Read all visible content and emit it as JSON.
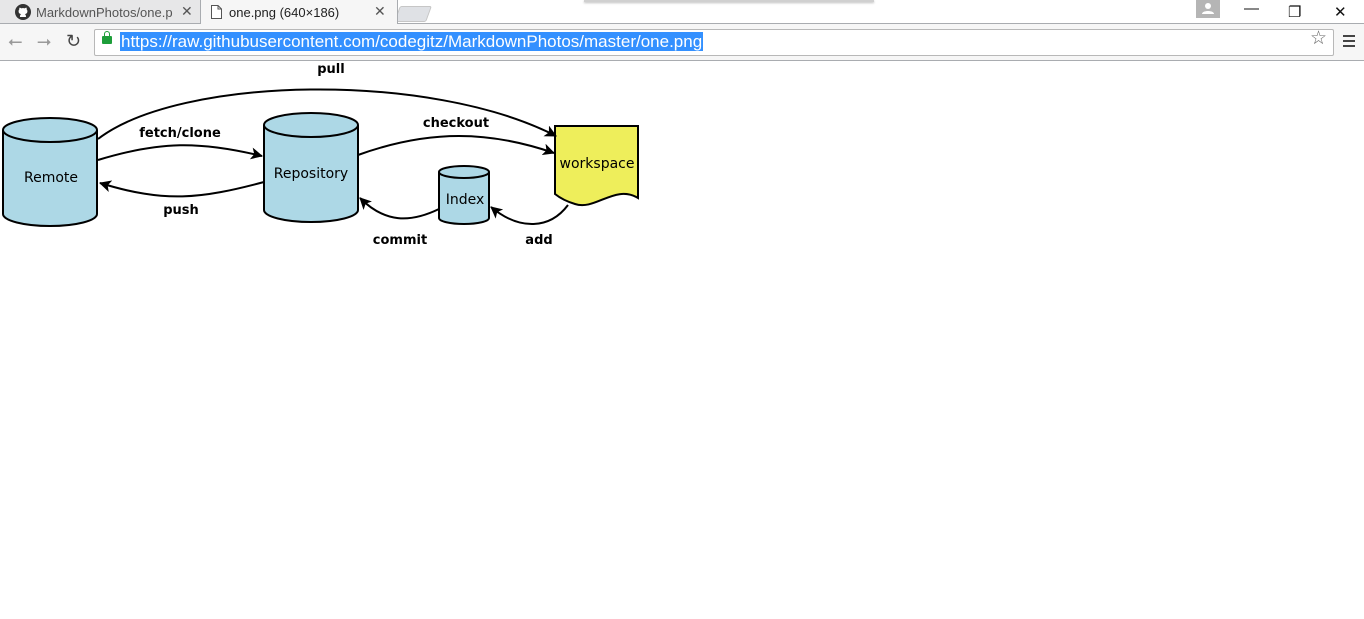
{
  "tabs": [
    {
      "title": "MarkdownPhotos/one.p",
      "icon": "github-icon",
      "active": false
    },
    {
      "title": "one.png (640×186)",
      "icon": "page-icon",
      "active": true
    }
  ],
  "toolbar": {
    "url": "https://raw.githubusercontent.com/codegitz/MarkdownPhotos/master/one.png"
  },
  "image": {
    "nodes": {
      "remote": "Remote",
      "repository": "Repository",
      "index": "Index",
      "workspace": "workspace"
    },
    "edges": {
      "pull": "pull",
      "fetch_clone": "fetch/clone",
      "push": "push",
      "checkout": "checkout",
      "commit": "commit",
      "add": "add"
    },
    "colors": {
      "store_fill": "#add8e6",
      "workspace_fill": "#eeee5b"
    }
  }
}
